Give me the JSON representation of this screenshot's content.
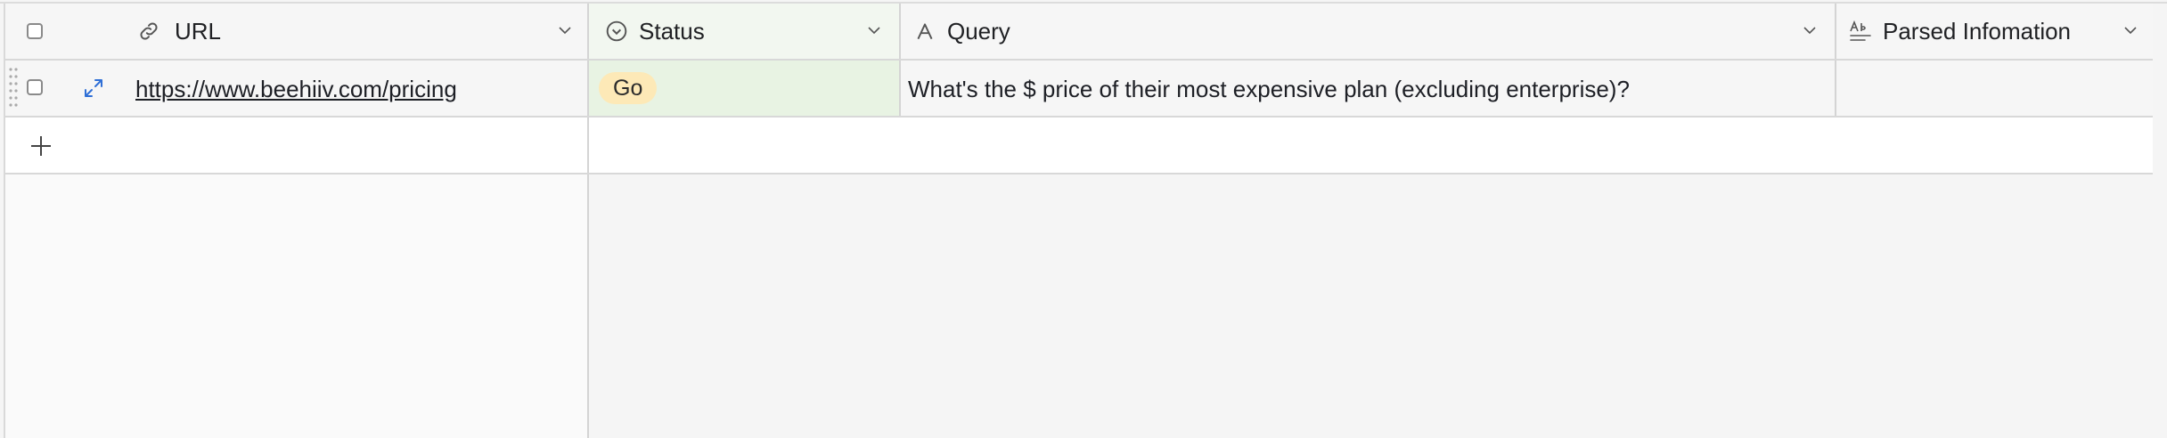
{
  "columns": [
    {
      "title": "URL",
      "icon": "link-icon"
    },
    {
      "title": "Status",
      "icon": "status-select-icon"
    },
    {
      "title": "Query",
      "icon": "text-field-icon"
    },
    {
      "title": "Parsed Infomation",
      "icon": "ai-text-icon"
    }
  ],
  "rows": [
    {
      "url": "https://www.beehiiv.com/pricing",
      "status": "Go",
      "query": "What's the $ price of their most expensive plan (excluding enterprise)?",
      "parsed": ""
    }
  ],
  "add_row": {
    "icon": "plus-icon"
  },
  "colors": {
    "status_pill": "#fde9b7",
    "status_column": "#e8f3e3",
    "expand_icon": "#2f6fd6"
  }
}
